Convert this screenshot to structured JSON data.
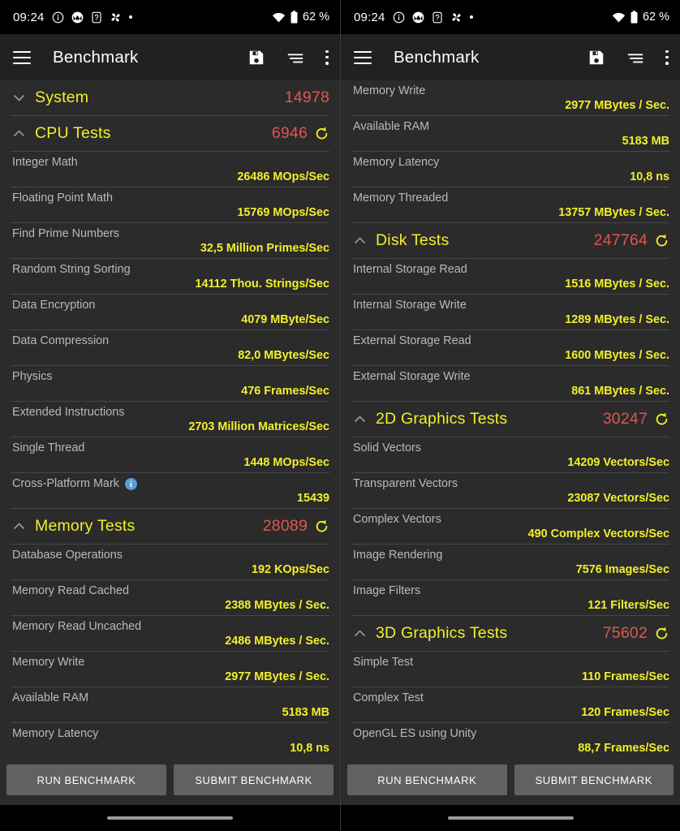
{
  "statusbar": {
    "clock": "09:24",
    "battery_text": "62 %",
    "icons": [
      "info-icon",
      "motorola-icon",
      "sim-card-icon",
      "pinwheel-icon",
      "dot-icon"
    ],
    "right_icons": [
      "wifi-icon",
      "battery-icon"
    ]
  },
  "appbar": {
    "title": "Benchmark",
    "menu_icon": "hamburger-menu-icon",
    "actions": [
      "save-icon",
      "sort-icon",
      "overflow-menu-icon"
    ]
  },
  "colors": {
    "background": "#2b2b2b",
    "appbar": "#212121",
    "group_label": "#f2ef2a",
    "group_score": "#e0564f",
    "test_name": "#b9b9b9",
    "test_value": "#f2ef2a",
    "divider": "#464646",
    "button": "#616161",
    "info_badge": "#5b9bd5"
  },
  "buttons": {
    "run": "RUN BENCHMARK",
    "submit": "SUBMIT BENCHMARK"
  },
  "left_pane": {
    "rows": [
      {
        "kind": "group",
        "label": "System",
        "score": "14978",
        "expanded": false,
        "refresh": false
      },
      {
        "kind": "group",
        "label": "CPU Tests",
        "score": "6946",
        "expanded": true,
        "refresh": true
      },
      {
        "kind": "test",
        "label": "Integer Math",
        "value": "26486 MOps/Sec"
      },
      {
        "kind": "test",
        "label": "Floating Point Math",
        "value": "15769 MOps/Sec"
      },
      {
        "kind": "test",
        "label": "Find Prime Numbers",
        "value": "32,5 Million Primes/Sec"
      },
      {
        "kind": "test",
        "label": "Random String Sorting",
        "value": "14112 Thou. Strings/Sec"
      },
      {
        "kind": "test",
        "label": "Data Encryption",
        "value": "4079 MByte/Sec"
      },
      {
        "kind": "test",
        "label": "Data Compression",
        "value": "82,0 MBytes/Sec"
      },
      {
        "kind": "test",
        "label": "Physics",
        "value": "476 Frames/Sec"
      },
      {
        "kind": "test",
        "label": "Extended Instructions",
        "value": "2703 Million Matrices/Sec"
      },
      {
        "kind": "test",
        "label": "Single Thread",
        "value": "1448 MOps/Sec"
      },
      {
        "kind": "test",
        "label": "Cross-Platform Mark",
        "value": "15439",
        "info": true
      },
      {
        "kind": "group",
        "label": "Memory Tests",
        "score": "28089",
        "expanded": true,
        "refresh": true
      },
      {
        "kind": "test",
        "label": "Database Operations",
        "value": "192 KOps/Sec"
      },
      {
        "kind": "test",
        "label": "Memory Read Cached",
        "value": "2388 MBytes / Sec."
      },
      {
        "kind": "test",
        "label": "Memory Read Uncached",
        "value": "2486 MBytes / Sec."
      },
      {
        "kind": "test",
        "label": "Memory Write",
        "value": "2977 MBytes / Sec."
      },
      {
        "kind": "test",
        "label": "Available RAM",
        "value": "5183 MB"
      },
      {
        "kind": "test",
        "label": "Memory Latency",
        "value": "10,8 ns"
      }
    ]
  },
  "right_pane": {
    "rows": [
      {
        "kind": "test",
        "label": "Memory Write",
        "value": "2977 MBytes / Sec."
      },
      {
        "kind": "test",
        "label": "Available RAM",
        "value": "5183 MB"
      },
      {
        "kind": "test",
        "label": "Memory Latency",
        "value": "10,8 ns"
      },
      {
        "kind": "test",
        "label": "Memory Threaded",
        "value": "13757 MBytes / Sec."
      },
      {
        "kind": "group",
        "label": "Disk Tests",
        "score": "247764",
        "expanded": true,
        "refresh": true
      },
      {
        "kind": "test",
        "label": "Internal Storage Read",
        "value": "1516 MBytes / Sec."
      },
      {
        "kind": "test",
        "label": "Internal Storage Write",
        "value": "1289 MBytes / Sec."
      },
      {
        "kind": "test",
        "label": "External Storage Read",
        "value": "1600 MBytes / Sec."
      },
      {
        "kind": "test",
        "label": "External Storage Write",
        "value": "861 MBytes / Sec."
      },
      {
        "kind": "group",
        "label": "2D Graphics Tests",
        "score": "30247",
        "expanded": true,
        "refresh": true
      },
      {
        "kind": "test",
        "label": "Solid Vectors",
        "value": "14209 Vectors/Sec"
      },
      {
        "kind": "test",
        "label": "Transparent Vectors",
        "value": "23087 Vectors/Sec"
      },
      {
        "kind": "test",
        "label": "Complex Vectors",
        "value": "490 Complex Vectors/Sec"
      },
      {
        "kind": "test",
        "label": "Image Rendering",
        "value": "7576 Images/Sec"
      },
      {
        "kind": "test",
        "label": "Image Filters",
        "value": "121 Filters/Sec"
      },
      {
        "kind": "group",
        "label": "3D Graphics Tests",
        "score": "75602",
        "expanded": true,
        "refresh": true
      },
      {
        "kind": "test",
        "label": "Simple Test",
        "value": "110 Frames/Sec"
      },
      {
        "kind": "test",
        "label": "Complex Test",
        "value": "120 Frames/Sec"
      },
      {
        "kind": "test",
        "label": "OpenGL ES using Unity",
        "value": "88,7 Frames/Sec"
      }
    ]
  }
}
